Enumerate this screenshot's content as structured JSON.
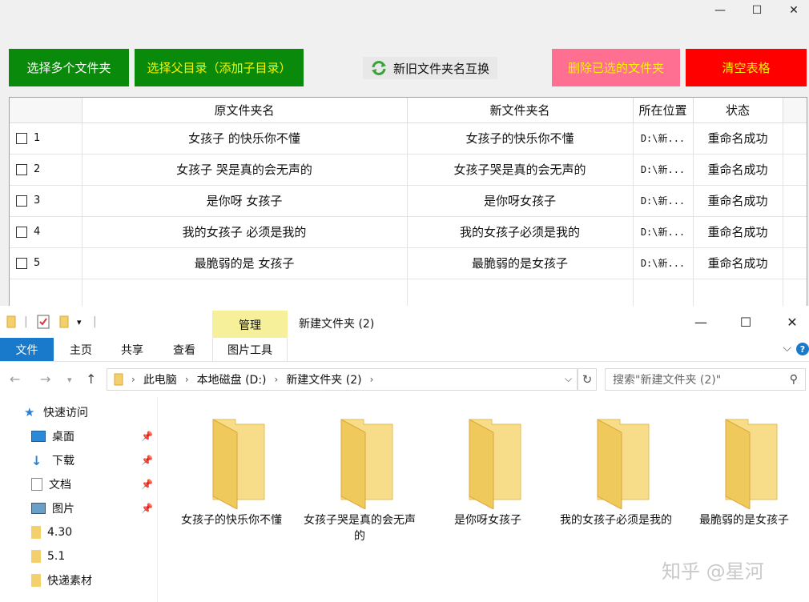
{
  "app": {
    "window_controls": {
      "minimize": "—",
      "maximize": "☐",
      "close": "✕"
    },
    "buttons": {
      "select_multiple": "选择多个文件夹",
      "select_parent": "选择父目录（添加子目录）",
      "swap_names": "新旧文件夹名互换",
      "delete_selected": "删除已选的文件夹",
      "clear_table": "清空表格"
    },
    "columns": {
      "original": "原文件夹名",
      "new": "新文件夹名",
      "location": "所在位置",
      "status": "状态"
    },
    "rows": [
      {
        "num": "1",
        "original": "女孩子 的快乐你不懂",
        "new": "女孩子的快乐你不懂",
        "location": "D:\\新...",
        "status": "重命名成功"
      },
      {
        "num": "2",
        "original": "女孩子 哭是真的会无声的",
        "new": "女孩子哭是真的会无声的",
        "location": "D:\\新...",
        "status": "重命名成功"
      },
      {
        "num": "3",
        "original": "是你呀 女孩子",
        "new": "是你呀女孩子",
        "location": "D:\\新...",
        "status": "重命名成功"
      },
      {
        "num": "4",
        "original": "我的女孩子 必须是我的",
        "new": "我的女孩子必须是我的",
        "location": "D:\\新...",
        "status": "重命名成功"
      },
      {
        "num": "5",
        "original": "最脆弱的是 女孩子",
        "new": "最脆弱的是女孩子",
        "location": "D:\\新...",
        "status": "重命名成功"
      }
    ]
  },
  "explorer": {
    "manage_tab": "管理",
    "title": "新建文件夹 (2)",
    "window_controls": {
      "minimize": "—",
      "maximize": "☐",
      "close": "✕"
    },
    "ribbon_tabs": {
      "file": "文件",
      "home": "主页",
      "share": "共享",
      "view": "查看",
      "picture_tools": "图片工具"
    },
    "breadcrumb": [
      "此电脑",
      "本地磁盘 (D:)",
      "新建文件夹 (2)"
    ],
    "search_placeholder": "搜索\"新建文件夹 (2)\"",
    "nav_items": [
      {
        "label": "快速访问"
      },
      {
        "label": "桌面"
      },
      {
        "label": "下载"
      },
      {
        "label": "文档"
      },
      {
        "label": "图片"
      },
      {
        "label": "4.30"
      },
      {
        "label": "5.1"
      },
      {
        "label": "快递素材"
      }
    ],
    "folders": [
      {
        "name": "女孩子的快乐你不懂"
      },
      {
        "name": "女孩子哭是真的会无声的"
      },
      {
        "name": "是你呀女孩子"
      },
      {
        "name": "我的女孩子必须是我的"
      },
      {
        "name": "最脆弱的是女孩子"
      }
    ]
  },
  "watermark": "知乎 @星河",
  "colors": {
    "green": "#0a8a0a",
    "pink": "#ff6f91",
    "red": "#ff0000",
    "yellow_text": "#f5f500",
    "ribbon_blue": "#1979ca",
    "folder": "#f3d06b"
  }
}
